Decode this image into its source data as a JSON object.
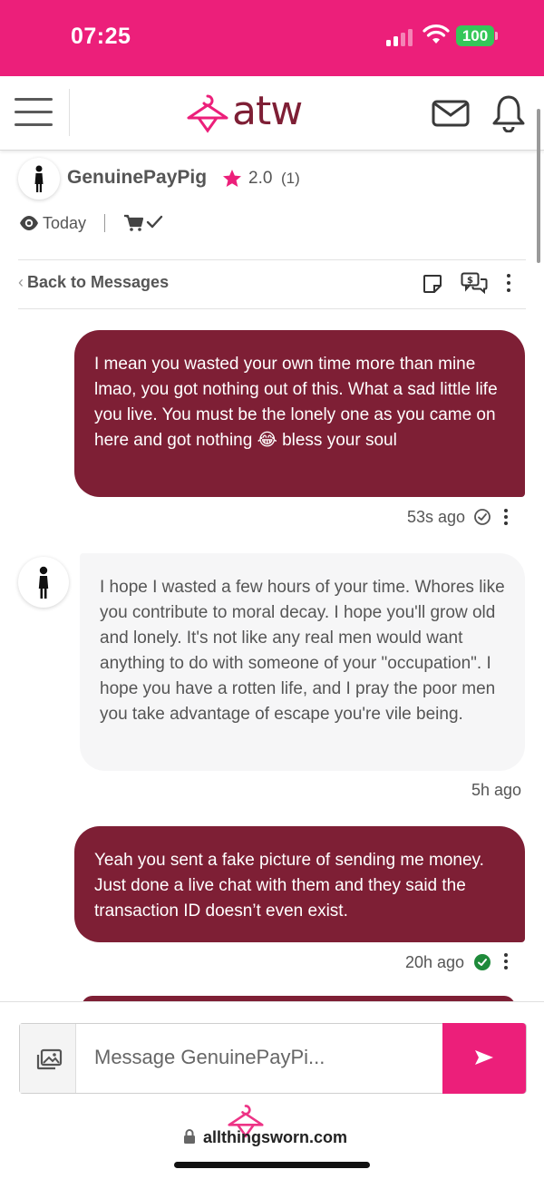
{
  "status_bar": {
    "time": "07:25",
    "battery": "100"
  },
  "header": {
    "logo_text": "atw"
  },
  "profile": {
    "name": "GenuinePayPig",
    "rating": "2.0",
    "rating_count": "(1)",
    "last_seen": "Today"
  },
  "toolbar": {
    "back_label": "Back to Messages",
    "back_chevron": "‹"
  },
  "messages": [
    {
      "direction": "outgoing",
      "text": "I mean you wasted your own time more than mine lmao, you got nothing out of this. What a sad little life you live. You must be the lonely one as you came on here and got nothing 😂 bless your soul",
      "time": "53s ago",
      "status": "sent"
    },
    {
      "direction": "incoming",
      "text": "I hope I wasted a few hours of your time. Whores like you contribute to moral decay. I hope you'll grow old and lonely. It's not like any real men would want anything to do with someone of your \"occupation\". I hope you have a rotten life, and I pray the poor men you take advantage of escape you're vile being.",
      "time": "5h ago"
    },
    {
      "direction": "outgoing",
      "text": "Yeah you sent a fake picture of sending me money. Just done a live chat with them and they said the transaction ID doesn’t even exist.",
      "time": "20h ago",
      "status": "read"
    }
  ],
  "compose": {
    "placeholder": "Message GenuinePayPi..."
  },
  "browser": {
    "url": "allthingsworn.com"
  },
  "colors": {
    "brand_pink": "#ec1f7a",
    "brand_maroon": "#7e1f35",
    "read_green": "#1e8a3a"
  },
  "icons": [
    "signal-icon",
    "wifi-icon",
    "menu-icon",
    "logo-hanger-icon",
    "mail-icon",
    "bell-icon",
    "avatar-icon",
    "star-icon",
    "eye-icon",
    "cart-check-icon",
    "note-icon",
    "money-chat-icon",
    "more-icon",
    "check-circle-icon",
    "image-attach-icon",
    "send-icon",
    "lock-icon"
  ]
}
